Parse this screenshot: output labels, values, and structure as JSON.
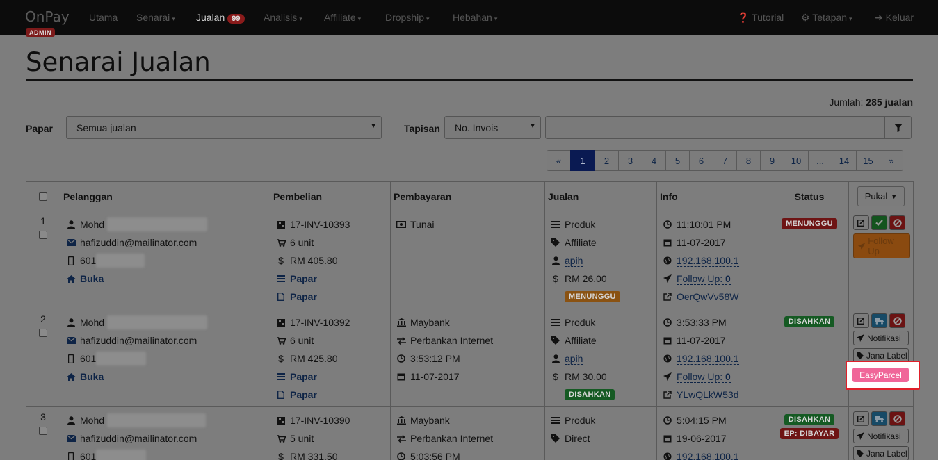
{
  "navbar": {
    "brand": "OnPay",
    "admin_badge": "ADMIN",
    "items": [
      {
        "label": "Utama",
        "caret": false
      },
      {
        "label": "Senarai",
        "caret": true
      },
      {
        "label": "Jualan",
        "caret": false,
        "badge": "99",
        "active": true
      },
      {
        "label": "Analisis",
        "caret": true
      },
      {
        "label": "Affiliate",
        "caret": true
      },
      {
        "label": "Dropship",
        "caret": true
      },
      {
        "label": "Hebahan",
        "caret": true
      }
    ],
    "right": [
      {
        "label": "Tutorial",
        "icon": "question-circle-icon"
      },
      {
        "label": "Tetapan",
        "icon": "gears-icon",
        "caret": true
      },
      {
        "label": "Keluar",
        "icon": "sign-out-icon"
      }
    ]
  },
  "page": {
    "title": "Senarai Jualan",
    "total_label": "Jumlah:",
    "total_value": "285 jualan"
  },
  "filters": {
    "papar_label": "Papar",
    "papar_value": "Semua jualan",
    "tapisan_label": "Tapisan",
    "tapisan_value": "No. Invois",
    "search_value": ""
  },
  "pagination": [
    "«",
    "1",
    "2",
    "3",
    "4",
    "5",
    "6",
    "7",
    "8",
    "9",
    "10",
    "...",
    "14",
    "15",
    "»"
  ],
  "pagination_active": "1",
  "table": {
    "headers": {
      "pelanggan": "Pelanggan",
      "pembelian": "Pembelian",
      "pembayaran": "Pembayaran",
      "jualan": "Jualan",
      "info": "Info",
      "status": "Status",
      "pukal": "Pukal"
    },
    "rows": [
      {
        "num": "1",
        "name": "Mohd",
        "email": "hafizuddin@mailinator.com",
        "phone": "601",
        "open": "Buka",
        "invoice": "17-INV-10393",
        "units": "6 unit",
        "amount": "RM 405.80",
        "view1": "Papar",
        "view2": "Papar",
        "pay_method": "Tunai",
        "pay_type": "",
        "pay_time": "",
        "pay_date": "",
        "sale_type": "Produk",
        "sale_channel": "Affiliate",
        "affiliate": "apih",
        "commission": "RM 26.00",
        "sale_badge": "MENUNGGU",
        "time": "11:10:01 PM",
        "date": "11-07-2017",
        "ip": "192.168.100.1",
        "follow_label": "Follow Up:",
        "follow_count": "0",
        "ref": "OerQwVv58W",
        "status": [
          "MENUNGGU"
        ],
        "actions": {
          "follow": "Follow Up"
        }
      },
      {
        "num": "2",
        "name": "Mohd",
        "email": "hafizuddin@mailinator.com",
        "phone": "601",
        "open": "Buka",
        "invoice": "17-INV-10392",
        "units": "6 unit",
        "amount": "RM 425.80",
        "view1": "Papar",
        "view2": "Papar",
        "pay_method": "Maybank",
        "pay_type": "Perbankan Internet",
        "pay_time": "3:53:12 PM",
        "pay_date": "11-07-2017",
        "sale_type": "Produk",
        "sale_channel": "Affiliate",
        "affiliate": "apih",
        "commission": "RM 30.00",
        "sale_badge": "DISAHKAN",
        "time": "3:53:33 PM",
        "date": "11-07-2017",
        "ip": "192.168.100.1",
        "follow_label": "Follow Up:",
        "follow_count": "0",
        "ref": "YLwQLkW53d",
        "status": [
          "DISAHKAN"
        ],
        "actions": {
          "notify": "Notifikasi",
          "label": "Jana Label",
          "easyparcel": "EasyParcel"
        }
      },
      {
        "num": "3",
        "name": "Mohd",
        "email": "hafizuddin@mailinator.com",
        "phone": "601",
        "invoice": "17-INV-10390",
        "units": "5 unit",
        "amount": "RM 331.50",
        "pay_method": "Maybank",
        "pay_type": "Perbankan Internet",
        "pay_time": "5:03:56 PM",
        "sale_type": "Produk",
        "sale_channel": "Direct",
        "time": "5:04:15 PM",
        "date": "19-06-2017",
        "ip": "192.168.100.1",
        "status": [
          "DISAHKAN",
          "EP: DIBAYAR"
        ],
        "actions": {
          "notify": "Notifikasi",
          "label": "Jana Label"
        }
      }
    ]
  }
}
